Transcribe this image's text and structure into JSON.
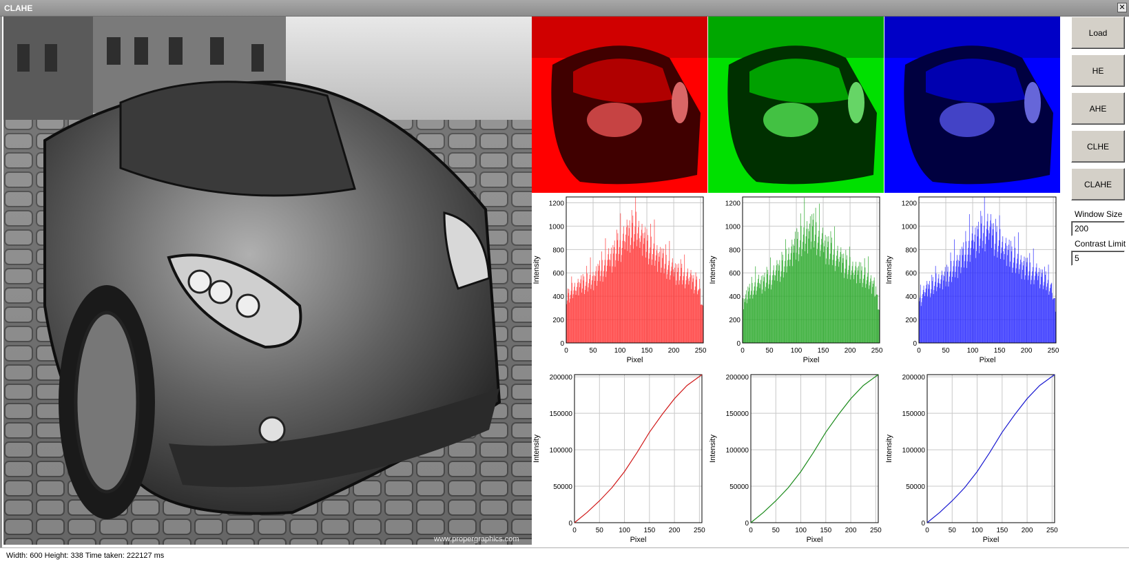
{
  "window": {
    "title": "CLAHE",
    "close_glyph": "✕"
  },
  "image": {
    "watermark": "www.propergraphics.com"
  },
  "buttons": [
    "Load",
    "HE",
    "AHE",
    "CLHE",
    "CLAHE"
  ],
  "params": {
    "window_size_label": "Window Size",
    "window_size_value": "200",
    "contrast_limit_label": "Contrast Limit",
    "contrast_limit_value": "5"
  },
  "status": {
    "text": "Width: 600 Height: 338 Time taken: 222127 ms"
  },
  "colors": {
    "red": "#ff3b3b",
    "green": "#2eaa2e",
    "blue": "#2f2fff",
    "red_line": "#d01818",
    "green_line": "#1a8a1a",
    "blue_line": "#1818d0"
  },
  "chart_data": [
    {
      "type": "bar",
      "channel": "red",
      "xlabel": "Pixel",
      "ylabel": "Intensity",
      "xlim": [
        0,
        255
      ],
      "ylim": [
        0,
        1250
      ],
      "xticks": [
        0,
        50,
        100,
        150,
        200,
        250
      ],
      "yticks": [
        0,
        200,
        400,
        600,
        800,
        1000,
        1200
      ],
      "grid": true,
      "envelope_x": [
        0,
        10,
        25,
        50,
        80,
        100,
        120,
        130,
        150,
        175,
        200,
        225,
        245,
        255
      ],
      "envelope_y": [
        420,
        500,
        560,
        620,
        800,
        950,
        1080,
        1100,
        950,
        820,
        700,
        640,
        560,
        300
      ]
    },
    {
      "type": "bar",
      "channel": "green",
      "xlabel": "Pixel",
      "ylabel": "Intensity",
      "xlim": [
        0,
        255
      ],
      "ylim": [
        0,
        1250
      ],
      "xticks": [
        0,
        50,
        100,
        150,
        200,
        250
      ],
      "yticks": [
        0,
        200,
        400,
        600,
        800,
        1000,
        1200
      ],
      "grid": true,
      "envelope_x": [
        0,
        10,
        25,
        50,
        80,
        100,
        120,
        130,
        150,
        175,
        200,
        225,
        245,
        255
      ],
      "envelope_y": [
        380,
        480,
        560,
        620,
        780,
        950,
        1060,
        1100,
        960,
        840,
        720,
        660,
        560,
        300
      ]
    },
    {
      "type": "bar",
      "channel": "blue",
      "xlabel": "Pixel",
      "ylabel": "Intensity",
      "xlim": [
        0,
        255
      ],
      "ylim": [
        0,
        1250
      ],
      "xticks": [
        0,
        50,
        100,
        150,
        200,
        250
      ],
      "yticks": [
        0,
        200,
        400,
        600,
        800,
        1000,
        1200
      ],
      "grid": true,
      "envelope_x": [
        0,
        10,
        25,
        50,
        80,
        100,
        120,
        130,
        150,
        175,
        200,
        225,
        245,
        255
      ],
      "envelope_y": [
        400,
        500,
        560,
        640,
        820,
        980,
        1080,
        1110,
        960,
        830,
        720,
        650,
        560,
        330
      ]
    },
    {
      "type": "line",
      "channel": "red",
      "xlabel": "Pixel",
      "ylabel": "Intensity",
      "xlim": [
        0,
        255
      ],
      "ylim": [
        0,
        203000
      ],
      "xticks": [
        0,
        50,
        100,
        150,
        200,
        250
      ],
      "yticks": [
        0,
        50000,
        100000,
        150000,
        200000
      ],
      "grid": true,
      "x": [
        0,
        25,
        50,
        75,
        100,
        125,
        150,
        175,
        200,
        225,
        255
      ],
      "y": [
        0,
        14000,
        30000,
        48000,
        70000,
        96000,
        124000,
        148000,
        170000,
        188000,
        203000
      ]
    },
    {
      "type": "line",
      "channel": "green",
      "xlabel": "Pixel",
      "ylabel": "Intensity",
      "xlim": [
        0,
        255
      ],
      "ylim": [
        0,
        203000
      ],
      "xticks": [
        0,
        50,
        100,
        150,
        200,
        250
      ],
      "yticks": [
        0,
        50000,
        100000,
        150000,
        200000
      ],
      "grid": true,
      "x": [
        0,
        25,
        50,
        75,
        100,
        125,
        150,
        175,
        200,
        225,
        255
      ],
      "y": [
        0,
        14000,
        30000,
        48000,
        70000,
        96000,
        124000,
        148000,
        170000,
        188000,
        203000
      ]
    },
    {
      "type": "line",
      "channel": "blue",
      "xlabel": "Pixel",
      "ylabel": "Intensity",
      "xlim": [
        0,
        255
      ],
      "ylim": [
        0,
        203000
      ],
      "xticks": [
        0,
        50,
        100,
        150,
        200,
        250
      ],
      "yticks": [
        0,
        50000,
        100000,
        150000,
        200000
      ],
      "grid": true,
      "x": [
        0,
        25,
        50,
        75,
        100,
        125,
        150,
        175,
        200,
        225,
        255
      ],
      "y": [
        0,
        14000,
        30000,
        48000,
        70000,
        96000,
        124000,
        148000,
        170000,
        188000,
        203000
      ]
    }
  ]
}
